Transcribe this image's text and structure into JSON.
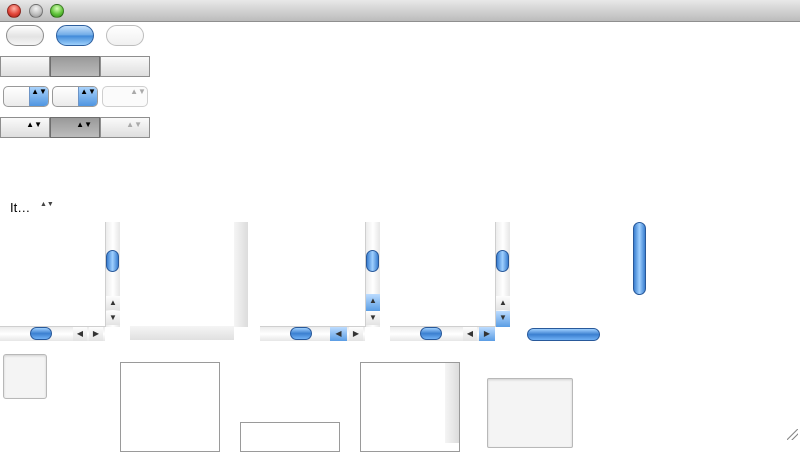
{
  "window": {
    "close_icon": "close-icon",
    "minimize_icon": "minimize-icon",
    "zoom_icon": "zoom-icon"
  },
  "popup_small": {
    "value": "It…",
    "arrows": "▲▼"
  },
  "scroller": {
    "up": "▲",
    "down": "▼",
    "left": "◀",
    "right": "▶"
  },
  "colors": {
    "accent": "#4f95e1",
    "titlebar": "#d2d2d2"
  }
}
